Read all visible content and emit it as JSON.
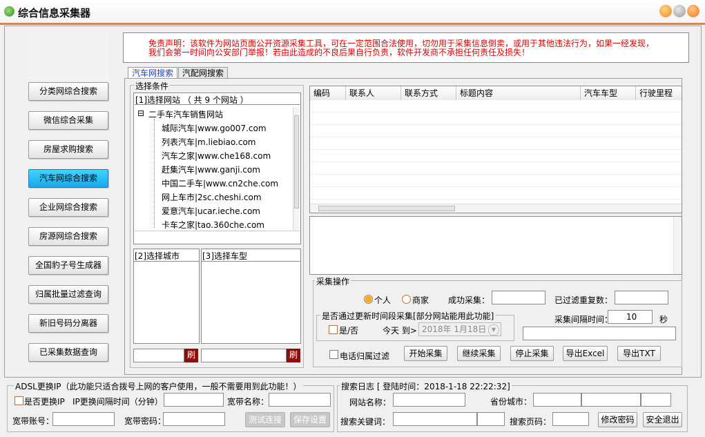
{
  "window": {
    "title": "综合信息采集器"
  },
  "disclaimer": {
    "line1": "免责声明：该软件为网站页面公开资源采集工具，可在一定范围合法使用，切勿用于采集信息倒卖，或用于其他违法行为，如果一经发现，",
    "line2": "我们会第一时间向公安部门举报！若由此造成的不良后果自行负责，软件开发商不承担任何责任及损失！"
  },
  "sidebar": {
    "items": [
      {
        "label": "分类网综合搜索"
      },
      {
        "label": "微信综合采集"
      },
      {
        "label": "房屋求购搜索"
      },
      {
        "label": "汽车网综合搜索"
      },
      {
        "label": "企业网综合搜索"
      },
      {
        "label": "房源网综合搜索"
      },
      {
        "label": "全国豹子号生成器"
      },
      {
        "label": "归属批量过滤查询"
      },
      {
        "label": "新旧号码分离器"
      },
      {
        "label": "已采集数据查询"
      }
    ]
  },
  "tabs": [
    {
      "label": "汽车网搜索"
    },
    {
      "label": "汽配网搜索"
    }
  ],
  "selection": {
    "group_title": "选择条件",
    "site_header": "[1]选择网站 （ 共 9 个网站 ）",
    "tree_root": "二手车汽车销售网站",
    "tree_expander": "⊟",
    "sites": [
      {
        "label": "城际汽车|www.go007.com"
      },
      {
        "label": "列表汽车|m.liebiao.com"
      },
      {
        "label": "汽车之家|www.che168.com"
      },
      {
        "label": "赶集汽车|www.ganji.com"
      },
      {
        "label": "中国二手车|www.cn2che.com"
      },
      {
        "label": "网上车市|2sc.cheshi.com"
      },
      {
        "label": "爱意汽车|ucar.ieche.com"
      },
      {
        "label": "卡车之家|tao.360che.com"
      }
    ],
    "city_header": "[2]选择城市",
    "model_header": "[3]选择车型",
    "refresh_label": "刷"
  },
  "results_table": {
    "columns": [
      {
        "label": "编码"
      },
      {
        "label": "联系人"
      },
      {
        "label": "联系方式"
      },
      {
        "label": "标题内容"
      },
      {
        "label": "汽车车型"
      },
      {
        "label": "行驶里程"
      }
    ]
  },
  "collect": {
    "group_title": "采集操作",
    "radio_personal": "个人",
    "radio_merchant": "商家",
    "success_label": "成功采集：",
    "dup_label": "已过滤重复数：",
    "time_group_title": "是否通过更新时间段采集[部分网站能用此功能]",
    "yes_no_label": "是/否",
    "today_label": "今天 到>",
    "date_value": "2018年  1月18日",
    "interval_label": "采集间隔时间：",
    "interval_value": "10",
    "interval_unit": "秒",
    "phone_filter_label": "电话归属过滤",
    "start_btn": "开始采集",
    "continue_btn": "继续采集",
    "stop_btn": "停止采集",
    "export_excel_btn": "导出Excel",
    "export_txt_btn": "导出TXT"
  },
  "adsl": {
    "group_title": "ADSL更换IP（此功能只适合拨号上网的客户使用，一般不需要用到此功能！）",
    "change_ip_label": "是否更换IP",
    "interval_label": "IP更换间隔时间（分钟）",
    "bb_name_label": "宽带名称：",
    "bb_account_label": "宽带账号：",
    "bb_password_label": "宽带密码：",
    "test_btn": "测试连接",
    "save_btn": "保存设置"
  },
  "search_log": {
    "group_title": "搜索日志 [ 登陆时间：2018-1-18 22:22:32]",
    "site_name_label": "网站名称：",
    "province_label": "省份城市：",
    "keyword_label": "搜索关键词：",
    "page_label": "搜索页码：",
    "change_pw_btn": "修改密码",
    "exit_btn": "安全退出"
  }
}
